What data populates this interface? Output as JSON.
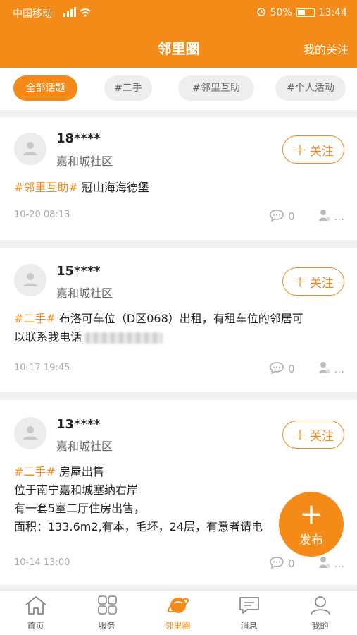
{
  "statusbar": {
    "carrier": "中国移动",
    "signal": "⁴ᴳ",
    "battery": "50%",
    "time": "13:44"
  },
  "header": {
    "title": "邻里圈",
    "my_follow": "我的关注"
  },
  "tabs": [
    {
      "label": "全部话题",
      "active": true
    },
    {
      "label": "#二手",
      "active": false
    },
    {
      "label": "#邻里互助",
      "active": false
    },
    {
      "label": "#个人活动",
      "active": false
    }
  ],
  "posts": [
    {
      "user": "18****",
      "community": "嘉和城社区",
      "follow_label": "关注",
      "tag": "#邻里互助#",
      "lines": [
        "冠山海海德堡"
      ],
      "time": "10-20 08:13",
      "comments": "0",
      "more": "..."
    },
    {
      "user": "15****",
      "community": "嘉和城社区",
      "follow_label": "关注",
      "tag": "#二手#",
      "lines": [
        "布洛可车位（D区068）出租，有租车位的邻居可",
        "以联系我电话"
      ],
      "time": "10-17 19:45",
      "comments": "0",
      "more": "..."
    },
    {
      "user": "13****",
      "community": "嘉和城社区",
      "follow_label": "关注",
      "tag": "#二手#",
      "lines": [
        "房屋出售",
        "位于南宁嘉和城塞纳右岸",
        "有一套5室二厅住房出售，",
        "面积：133.6m2,有本，毛坯，24层，有意者请电"
      ],
      "time": "10-14 13:00",
      "comments": "0",
      "more": "..."
    }
  ],
  "fab": {
    "plus": "+",
    "label": "发布"
  },
  "bottom_nav": [
    {
      "label": "首页",
      "icon": "home-icon",
      "active": false
    },
    {
      "label": "服务",
      "icon": "grid-icon",
      "active": false
    },
    {
      "label": "邻里圈",
      "icon": "planet-icon",
      "active": true
    },
    {
      "label": "消息",
      "icon": "message-icon",
      "active": false
    },
    {
      "label": "我的",
      "icon": "user-icon",
      "active": false
    }
  ],
  "colors": {
    "accent": "#f48a17",
    "muted": "#aaaaaa"
  }
}
